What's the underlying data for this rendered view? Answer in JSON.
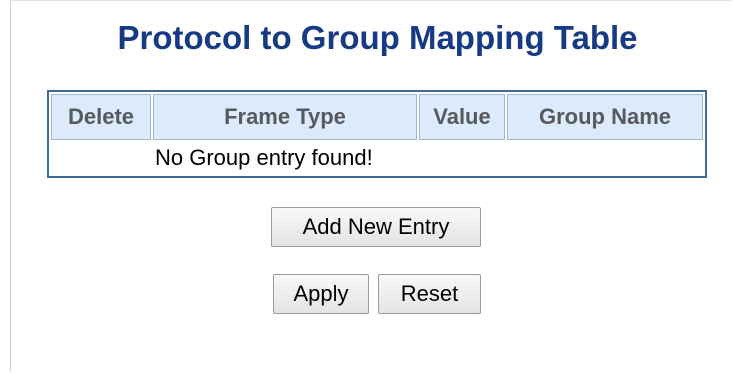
{
  "page": {
    "title": "Protocol to Group Mapping Table"
  },
  "table": {
    "headers": {
      "delete": "Delete",
      "frame_type": "Frame Type",
      "value": "Value",
      "group_name": "Group Name"
    },
    "empty_message": "No Group entry found!"
  },
  "buttons": {
    "add_new_entry": "Add New Entry",
    "apply": "Apply",
    "reset": "Reset"
  },
  "colors": {
    "title": "#163a84",
    "table_border": "#3e6c93",
    "header_background": "#ddeafc",
    "header_text": "#565a5e"
  }
}
